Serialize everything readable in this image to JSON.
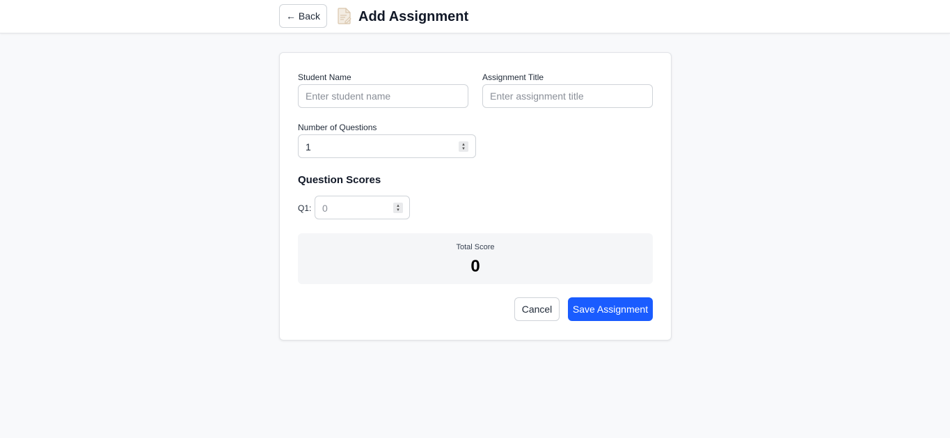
{
  "header": {
    "back_label": "← Back",
    "title": "Add Assignment",
    "title_icon": "assignment-document-icon"
  },
  "form": {
    "student_name": {
      "label": "Student Name",
      "placeholder": "Enter student name",
      "value": ""
    },
    "assignment_title": {
      "label": "Assignment Title",
      "placeholder": "Enter assignment title",
      "value": ""
    },
    "num_questions": {
      "label": "Number of Questions",
      "value": "1"
    },
    "question_scores": {
      "title": "Question Scores",
      "items": [
        {
          "label": "Q1:",
          "value": "0"
        }
      ]
    },
    "total": {
      "label": "Total Score",
      "value": "0"
    },
    "actions": {
      "cancel_label": "Cancel",
      "save_label": "Save Assignment"
    }
  },
  "colors": {
    "primary": "#1a5cff",
    "page_background": "#f8f9fb",
    "card_background": "#ffffff"
  }
}
